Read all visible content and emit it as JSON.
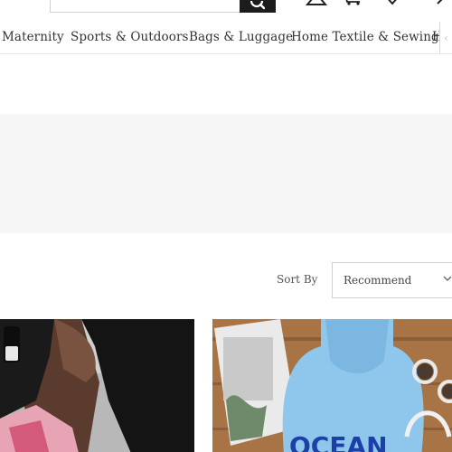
{
  "header": {
    "icons": [
      "search-icon",
      "account-icon",
      "cart-icon",
      "wishlist-icon",
      "more-icon"
    ]
  },
  "categories": [
    {
      "label": "Maternity"
    },
    {
      "label": "Sports & Outdoors"
    },
    {
      "label": "Bags & Luggage"
    },
    {
      "label": "Home Textile & Sewing"
    },
    {
      "label": "H"
    }
  ],
  "sort": {
    "label": "Sort By",
    "value": "Recommend"
  },
  "products": [
    {
      "image": "girl-pink-top-photo"
    },
    {
      "image": "blue-hoodie-flatlay-photo",
      "print_text": "OCEAN"
    }
  ],
  "colors": {
    "accent": "#1c1c1c",
    "banner": "#f6f6f6",
    "hoodie": "#8ec6ec"
  }
}
